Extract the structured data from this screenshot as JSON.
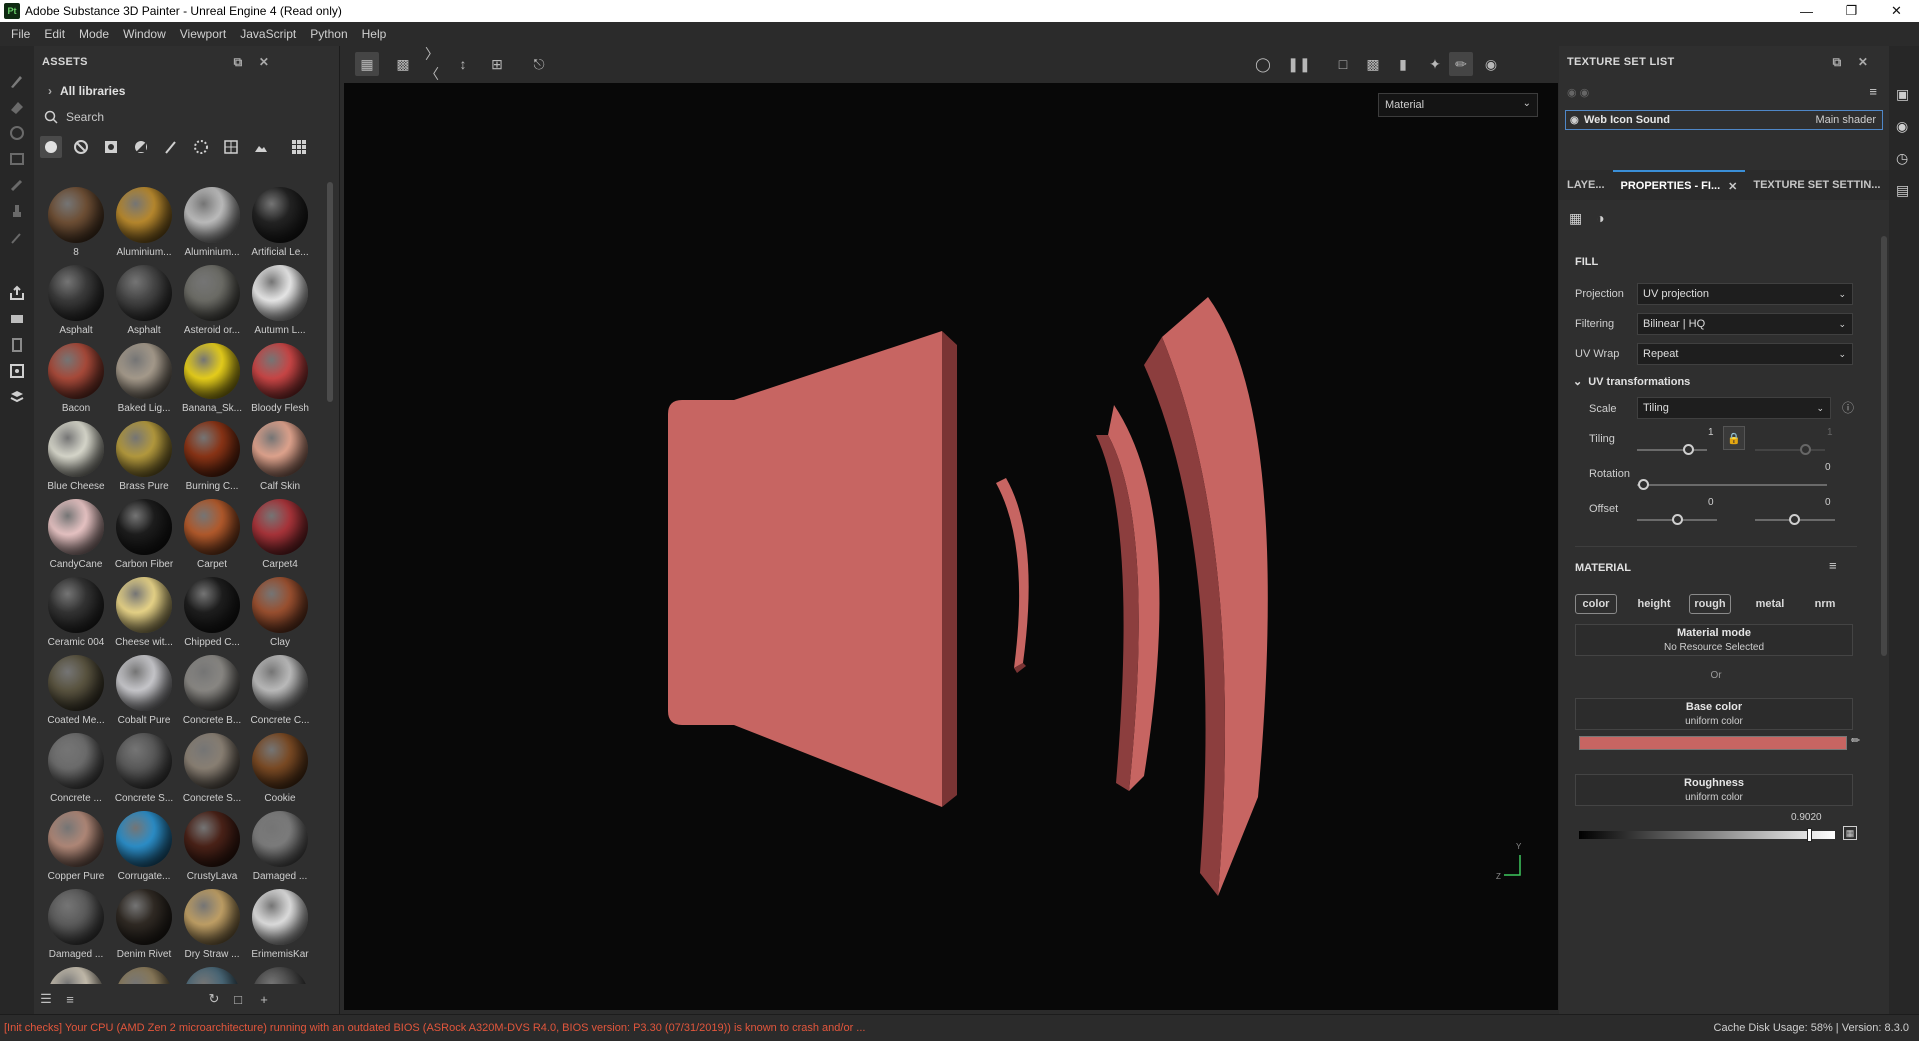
{
  "window": {
    "app_icon": "Pt",
    "title": "Adobe Substance 3D Painter - Unreal Engine 4 (Read only)"
  },
  "menu": [
    "File",
    "Edit",
    "Mode",
    "Window",
    "Viewport",
    "JavaScript",
    "Python",
    "Help"
  ],
  "assets": {
    "header": "ASSETS",
    "library": "All libraries",
    "search_placeholder": "Search",
    "items": [
      {
        "label": "8",
        "color": "#6e4f35"
      },
      {
        "label": "Aluminium...",
        "color": "#b8892e"
      },
      {
        "label": "Aluminium...",
        "color": "#bdbdbd"
      },
      {
        "label": "Artificial Le...",
        "color": "#232323"
      },
      {
        "label": "Asphalt",
        "color": "#3b3b3b"
      },
      {
        "label": "Asphalt",
        "color": "#464646"
      },
      {
        "label": "Asteroid or...",
        "color": "#6c6c66"
      },
      {
        "label": "Autumn L...",
        "color": "#e8e8e8"
      },
      {
        "label": "Bacon",
        "color": "#a84a3a"
      },
      {
        "label": "Baked Lig...",
        "color": "#a69b8c"
      },
      {
        "label": "Banana_Sk...",
        "color": "#e7cf1c"
      },
      {
        "label": "Bloody Flesh",
        "color": "#c94646"
      },
      {
        "label": "Blue Cheese",
        "color": "#d8d8cc"
      },
      {
        "label": "Brass Pure",
        "color": "#b49a3e"
      },
      {
        "label": "Burning C...",
        "color": "#8a3416"
      },
      {
        "label": "Calf Skin",
        "color": "#e0a48e"
      },
      {
        "label": "CandyCane",
        "color": "#e8c4c4"
      },
      {
        "label": "Carbon Fiber",
        "color": "#1d1d1d"
      },
      {
        "label": "Carpet",
        "color": "#b25a2c"
      },
      {
        "label": "Carpet4",
        "color": "#a8343a"
      },
      {
        "label": "Ceramic 004",
        "color": "#333333"
      },
      {
        "label": "Cheese wit...",
        "color": "#e8d488"
      },
      {
        "label": "Chipped C...",
        "color": "#1e1e1e"
      },
      {
        "label": "Clay",
        "color": "#9a5030"
      },
      {
        "label": "Coated Me...",
        "color": "#5a5440"
      },
      {
        "label": "Cobalt Pure",
        "color": "#c8c8cc"
      },
      {
        "label": "Concrete B...",
        "color": "#8a8884"
      },
      {
        "label": "Concrete C...",
        "color": "#bcbcbc"
      },
      {
        "label": "Concrete ...",
        "color": "#6c6c6c"
      },
      {
        "label": "Concrete S...",
        "color": "#5a5a5a"
      },
      {
        "label": "Concrete S...",
        "color": "#8a8074"
      },
      {
        "label": "Cookie",
        "color": "#7a4a24"
      },
      {
        "label": "Copper Pure",
        "color": "#b08878"
      },
      {
        "label": "Corrugate...",
        "color": "#2c8ec8"
      },
      {
        "label": "CrustyLava",
        "color": "#4a2218"
      },
      {
        "label": "Damaged ...",
        "color": "#7c7c7c"
      },
      {
        "label": "Damaged ...",
        "color": "#5c5c5c"
      },
      {
        "label": "Denim Rivet",
        "color": "#302a24"
      },
      {
        "label": "Dry Straw ...",
        "color": "#c0a066"
      },
      {
        "label": "ErimemisKar",
        "color": "#dedede"
      },
      {
        "label": "",
        "color": "#c8c0b0"
      },
      {
        "label": "",
        "color": "#8a7a5a"
      },
      {
        "label": "",
        "color": "#4a6878"
      },
      {
        "label": "",
        "color": "#4a4a4a"
      }
    ]
  },
  "viewport": {
    "mode_select": "Material",
    "model_color": "#c76562",
    "axis_y": "Y",
    "axis_z": "Z"
  },
  "texture_set_list": {
    "header": "TEXTURE SET LIST",
    "item_name": "Web Icon Sound",
    "item_shader": "Main shader"
  },
  "tabs": [
    "LAYE...",
    "PROPERTIES - FI...",
    "TEXTURE SET SETTIN..."
  ],
  "properties": {
    "fill_title": "FILL",
    "projection_label": "Projection",
    "projection_value": "UV projection",
    "filtering_label": "Filtering",
    "filtering_value": "Bilinear | HQ",
    "uvwrap_label": "UV Wrap",
    "uvwrap_value": "Repeat",
    "uv_transformations": "UV transformations",
    "scale_label": "Scale",
    "scale_value": "Tiling",
    "tiling_label": "Tiling",
    "tiling_value_1": "1",
    "tiling_value_2": "1",
    "rotation_label": "Rotation",
    "rotation_value": "0",
    "offset_label": "Offset",
    "offset_value_1": "0",
    "offset_value_2": "0",
    "material_title": "MATERIAL",
    "channels": [
      "color",
      "height",
      "rough",
      "metal",
      "nrm"
    ],
    "channels_on": [
      "color",
      "rough"
    ],
    "material_mode_title": "Material mode",
    "material_mode_sub": "No Resource Selected",
    "or_text": "Or",
    "base_color_title": "Base color",
    "base_color_sub": "uniform color",
    "base_color_value": "#c76562",
    "roughness_title": "Roughness",
    "roughness_sub": "uniform color",
    "roughness_value": "0.9020"
  },
  "status": {
    "warning": "[Init checks] Your CPU (AMD Zen 2 microarchitecture) running with an outdated BIOS (ASRock A320M-DVS R4.0, BIOS version: P3.30 (07/31/2019)) is known to crash and/or ...",
    "right": "Cache Disk Usage:   58% | Version: 8.3.0"
  }
}
